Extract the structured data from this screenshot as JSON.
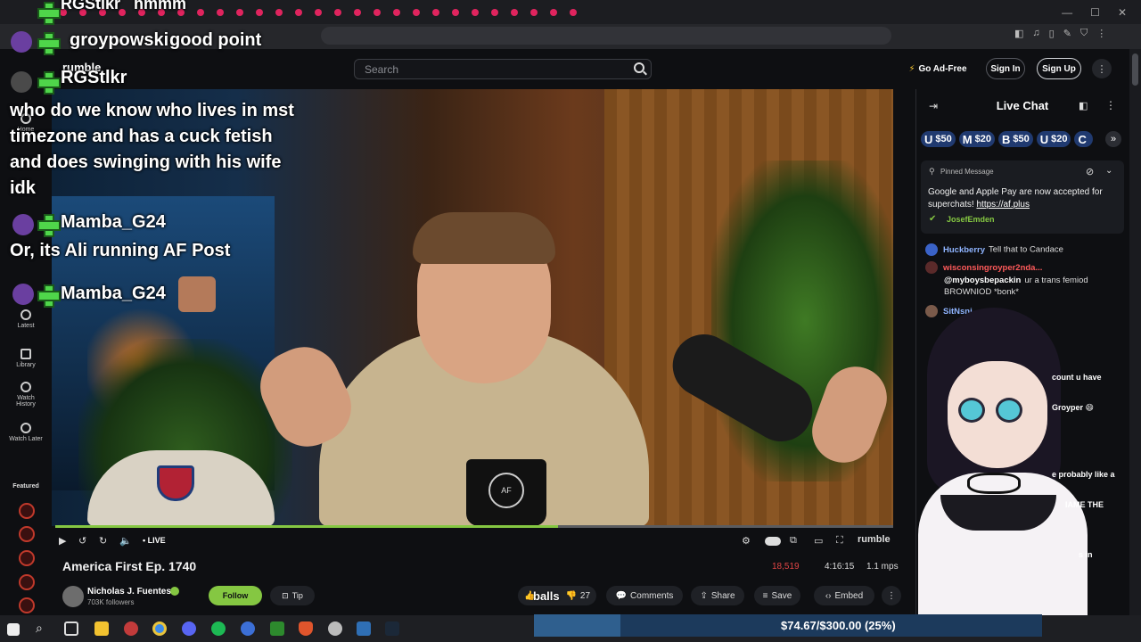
{
  "browser": {
    "window_controls": {
      "minimize": "—",
      "maximize": "☐",
      "close": "✕"
    }
  },
  "header": {
    "logo_text": "rumble",
    "search_placeholder": "Search",
    "ad_free_label": "Go Ad-Free",
    "sign_in_label": "Sign In",
    "sign_up_label": "Sign Up"
  },
  "sidebar": {
    "items": [
      {
        "label": "Home"
      },
      {
        "label": "Latest"
      },
      {
        "label": "Library"
      },
      {
        "label": "Watch History"
      },
      {
        "label": "Watch Later"
      }
    ],
    "featured_title": "Featured"
  },
  "player": {
    "live_label": "• LIVE",
    "brand": "rumble",
    "progress_fraction": 0.6
  },
  "video_info": {
    "title": "America First Ep. 1740",
    "views": "18,519",
    "duration": "4:16:15",
    "bitrate": "1.1 mps",
    "channel_name": "Nicholas J. Fuentes",
    "followers": "703K followers",
    "follow_label": "Follow",
    "tip_label": "Tip",
    "dislikes": "27",
    "comments_label": "Comments",
    "share_label": "Share",
    "save_label": "Save",
    "embed_label": "Embed",
    "mug_text": "AF"
  },
  "chat": {
    "title": "Live Chat",
    "tips": [
      {
        "letter": "U",
        "amount": "$50"
      },
      {
        "letter": "M",
        "amount": "$20"
      },
      {
        "letter": "B",
        "amount": "$50"
      },
      {
        "letter": "U",
        "amount": "$20"
      },
      {
        "letter": "C",
        "amount": ""
      }
    ],
    "tips_more": "»",
    "pinned": {
      "label": "Pinned Message",
      "text": "Google and Apple Pay are now accepted for superchats!",
      "link": "https://af.plus",
      "author": "JosefEmden"
    },
    "messages": [
      {
        "user": "Huckberry",
        "text": "Tell that to Candace",
        "color": "#8fb4ff"
      },
      {
        "user": "wisconsingroyper2nda...",
        "text": "",
        "color": "#ff5a5a"
      },
      {
        "user": "@myboysbepackin",
        "text": "ur a trans femiod BROWNIOD *bonk*",
        "color": "#ffffff"
      },
      {
        "user": "SitNsni",
        "text": "",
        "color": "#8fb4ff"
      }
    ],
    "fragments": [
      "count u have",
      "Groyper 😄",
      "e probably like a",
      "IAME THE",
      "s in"
    ]
  },
  "overlay": {
    "streamer_top": "RGStlkr",
    "top_message": "hmmm",
    "line1_user": "groypowski",
    "line1_msg": "good point",
    "streamer": "RGStlkr",
    "message_block": "who do we know who lives in mst timezone and has a cuck fetish and does swinging with his wife idk",
    "user2": "Mamba_G24",
    "message2": "Or, its Ali running AF Post",
    "user3": "Mamba_G24",
    "balls_text": "balls"
  },
  "donation_goal": {
    "text": "$74.67/$300.00 (25%)",
    "fraction": 0.25
  }
}
